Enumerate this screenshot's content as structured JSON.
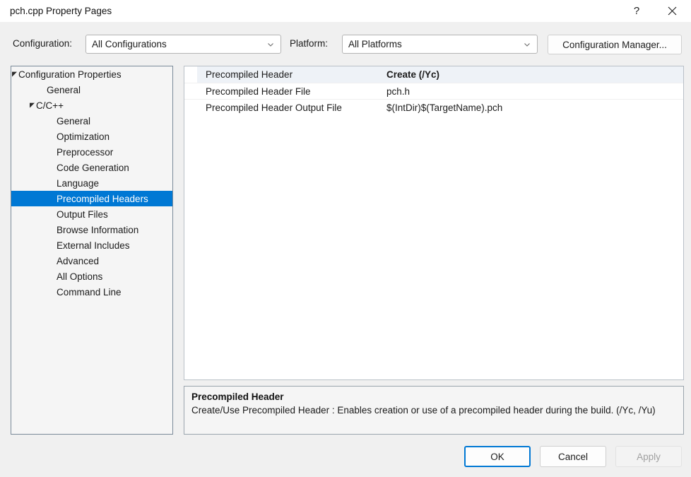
{
  "window": {
    "title": "pch.cpp Property Pages",
    "help_icon": "question-mark-icon",
    "close_icon": "close-icon"
  },
  "config_bar": {
    "configuration_label": "Configuration:",
    "configuration_value": "All Configurations",
    "platform_label": "Platform:",
    "platform_value": "All Platforms",
    "configuration_manager_label": "Configuration Manager...",
    "chevron_icon": "chevron-down-icon"
  },
  "tree": {
    "selection_color": "#0078d4",
    "items": [
      {
        "label": "Configuration Properties",
        "indent": 10,
        "expander": true,
        "selected": false
      },
      {
        "label": "General",
        "indent": 50,
        "expander": false,
        "selected": false
      },
      {
        "label": "C/C++",
        "indent": 35,
        "expander": true,
        "selected": false
      },
      {
        "label": "General",
        "indent": 64,
        "expander": false,
        "selected": false
      },
      {
        "label": "Optimization",
        "indent": 64,
        "expander": false,
        "selected": false
      },
      {
        "label": "Preprocessor",
        "indent": 64,
        "expander": false,
        "selected": false
      },
      {
        "label": "Code Generation",
        "indent": 64,
        "expander": false,
        "selected": false
      },
      {
        "label": "Language",
        "indent": 64,
        "expander": false,
        "selected": false
      },
      {
        "label": "Precompiled Headers",
        "indent": 64,
        "expander": false,
        "selected": true
      },
      {
        "label": "Output Files",
        "indent": 64,
        "expander": false,
        "selected": false
      },
      {
        "label": "Browse Information",
        "indent": 64,
        "expander": false,
        "selected": false
      },
      {
        "label": "External Includes",
        "indent": 64,
        "expander": false,
        "selected": false
      },
      {
        "label": "Advanced",
        "indent": 64,
        "expander": false,
        "selected": false
      },
      {
        "label": "All Options",
        "indent": 64,
        "expander": false,
        "selected": false
      },
      {
        "label": "Command Line",
        "indent": 64,
        "expander": false,
        "selected": false
      }
    ]
  },
  "property_grid": {
    "rows": [
      {
        "name": "Precompiled Header",
        "value": "Create (/Yc)",
        "bold": true,
        "highlighted": true
      },
      {
        "name": "Precompiled Header File",
        "value": "pch.h",
        "bold": false,
        "highlighted": false
      },
      {
        "name": "Precompiled Header Output File",
        "value": "$(IntDir)$(TargetName).pch",
        "bold": false,
        "highlighted": false
      }
    ]
  },
  "description": {
    "title": "Precompiled Header",
    "body": "Create/Use Precompiled Header : Enables creation or use of a precompiled header during the build. (/Yc, /Yu)"
  },
  "footer": {
    "ok_label": "OK",
    "cancel_label": "Cancel",
    "apply_label": "Apply"
  }
}
